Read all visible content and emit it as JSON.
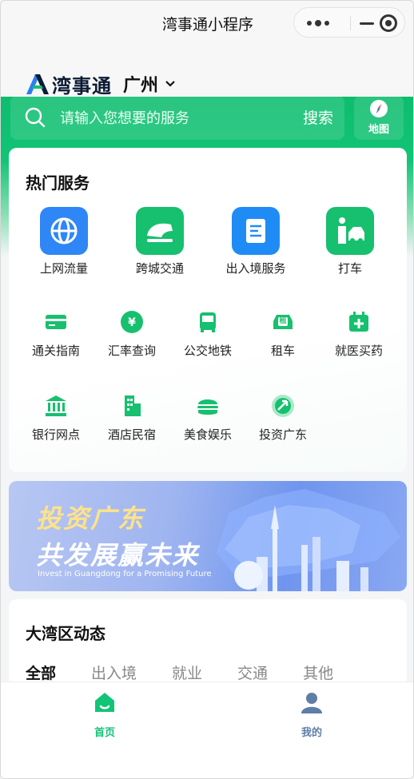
{
  "window": {
    "title": "湾事通小程序"
  },
  "brand": {
    "name": "湾事通",
    "city": "广州"
  },
  "search": {
    "placeholder": "请输入您想要的服务",
    "button": "搜索"
  },
  "map": {
    "label": "地图"
  },
  "hot_services": {
    "title": "热门服务",
    "featured": [
      {
        "label": "上网流量",
        "icon": "globe-icon",
        "color": "#2f86f6"
      },
      {
        "label": "跨城交通",
        "icon": "high-speed-train-icon",
        "color": "#16c06e"
      },
      {
        "label": "出入境服务",
        "icon": "document-icon",
        "color": "#1f8cf5"
      },
      {
        "label": "打车",
        "icon": "taxi-person-icon",
        "color": "#16c06e"
      }
    ],
    "items": [
      {
        "label": "通关指南",
        "icon": "card-icon"
      },
      {
        "label": "汇率查询",
        "icon": "yuan-icon"
      },
      {
        "label": "公交地铁",
        "icon": "bus-icon"
      },
      {
        "label": "租车",
        "icon": "rental-car-icon",
        "badge": "租"
      },
      {
        "label": "就医买药",
        "icon": "medical-icon"
      },
      {
        "label": "银行网点",
        "icon": "bank-icon"
      },
      {
        "label": "酒店民宿",
        "icon": "hotel-icon"
      },
      {
        "label": "美食娱乐",
        "icon": "burger-icon"
      },
      {
        "label": "投资广东",
        "icon": "investment-icon"
      }
    ]
  },
  "banner": {
    "line1": "投资广东",
    "line2": "共发展赢未来",
    "caption": "Invest in Guangdong for a Promising Future"
  },
  "news": {
    "title": "大湾区动态",
    "tabs": [
      "全部",
      "出入境",
      "就业",
      "交通",
      "其他"
    ],
    "active_tab": 0
  },
  "tabbar": {
    "items": [
      {
        "label": "首页",
        "icon": "home-icon",
        "active": true
      },
      {
        "label": "我的",
        "icon": "user-icon",
        "active": false
      }
    ]
  },
  "colors": {
    "brand_green": "#12c476",
    "inactive_tab": "#5f7ea6"
  }
}
